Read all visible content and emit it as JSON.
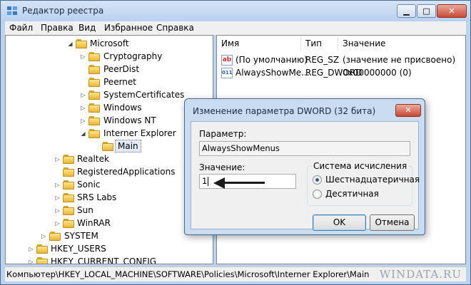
{
  "window": {
    "title": "Редактор реестра"
  },
  "menu": [
    "Файл",
    "Правка",
    "Вид",
    "Избранное",
    "Справка"
  ],
  "tree": [
    {
      "label": "Microsoft",
      "expander": "◢"
    },
    {
      "label": "Cryptography",
      "expander": "▷"
    },
    {
      "label": "PeerDist",
      "expander": ""
    },
    {
      "label": "Peernet",
      "expander": ""
    },
    {
      "label": "SystemCertificates",
      "expander": "▷"
    },
    {
      "label": "Windows",
      "expander": "▷"
    },
    {
      "label": "Windows NT",
      "expander": "▷"
    },
    {
      "label": "Interner Explorer",
      "expander": "◢"
    },
    {
      "label": "Main",
      "expander": ""
    },
    {
      "label": "Realtek",
      "expander": "▷"
    },
    {
      "label": "RegisteredApplications",
      "expander": ""
    },
    {
      "label": "Sonic",
      "expander": "▷"
    },
    {
      "label": "SRS Labs",
      "expander": "▷"
    },
    {
      "label": "Sun",
      "expander": "▷"
    },
    {
      "label": "WinRAR",
      "expander": "▷"
    },
    {
      "label": "SYSTEM",
      "expander": "▷"
    },
    {
      "label": "HKEY_USERS",
      "expander": "▷"
    },
    {
      "label": "HKEY_CURRENT_CONFIG",
      "expander": "▷"
    }
  ],
  "values_table": {
    "headers": [
      "Имя",
      "Тип",
      "Значение"
    ],
    "rows": [
      {
        "icon": "ab",
        "name": "(По умолчанию)",
        "type": "REG_SZ",
        "value": "(значение не присвоено)"
      },
      {
        "icon": "011",
        "name": "AlwaysShowMe...",
        "type": "REG_DWORD",
        "value": "0x00000000 (0)"
      }
    ]
  },
  "dialog": {
    "title": "Изменение параметра DWORD (32 бита)",
    "param_label": "Параметр:",
    "param_value": "AlwaysShowMenus",
    "value_label": "Значение:",
    "value_input": "1",
    "base_group_title": "Система исчисления",
    "radio_hex": "Шестнадцатеричная",
    "radio_dec": "Десятичная",
    "selected_base": "hex",
    "ok": "OK",
    "cancel": "Отмена"
  },
  "statusbar": {
    "path": "Компьютер\\HKEY_LOCAL_MACHINE\\SOFTWARE\\Policies\\Microsoft\\Interner Explorer\\Main"
  },
  "watermark": "WINDATA.RU"
}
